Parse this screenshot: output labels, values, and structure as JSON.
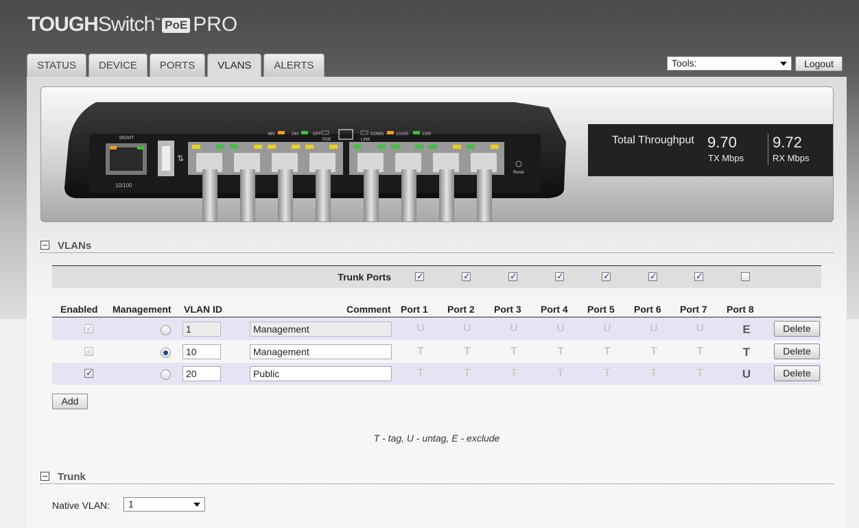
{
  "brand": {
    "part1": "TOUGH",
    "part2": "Switch",
    "tm": "™",
    "badge": "PoE",
    "part3": "PRO"
  },
  "tabs": [
    {
      "label": "STATUS",
      "active": false
    },
    {
      "label": "DEVICE",
      "active": false
    },
    {
      "label": "PORTS",
      "active": false
    },
    {
      "label": "VLANS",
      "active": true
    },
    {
      "label": "ALERTS",
      "active": false
    }
  ],
  "header": {
    "tools_value": "Tools:",
    "logout_label": "Logout"
  },
  "device_panel": {
    "mgmt_label": "MGMT",
    "mgmt_speed": "10/100",
    "legend_48v": "48V",
    "legend_24v": "24V",
    "legend_off": "OFF",
    "legend_poe": "POE",
    "legend_down": "DOWN",
    "legend_10100": "10/100",
    "legend_1000": "1000",
    "legend_link": "LINK",
    "reset_label": "Reset",
    "colors": {
      "amber": "#e8a020",
      "green": "#40c040",
      "yellow": "#e8d020"
    }
  },
  "throughput": {
    "title": "Total Throughput",
    "tx_value": "9.70",
    "tx_unit": "TX Mbps",
    "rx_value": "9.72",
    "rx_unit": "RX Mbps"
  },
  "vlans": {
    "section_title": "VLANs",
    "trunk_ports_label": "Trunk Ports",
    "trunk_ports": [
      true,
      true,
      true,
      true,
      true,
      true,
      true,
      false
    ],
    "columns": {
      "enabled": "Enabled",
      "management": "Management",
      "vlan_id": "VLAN ID",
      "comment": "Comment",
      "ports": [
        "Port 1",
        "Port 2",
        "Port 3",
        "Port 4",
        "Port 5",
        "Port 6",
        "Port 7",
        "Port 8"
      ]
    },
    "rows": [
      {
        "enabled": true,
        "enabled_disabled": true,
        "management": false,
        "vlan_id": "1",
        "vlan_readonly": true,
        "comment": "Management",
        "comment_readonly": true,
        "ports": [
          "U",
          "U",
          "U",
          "U",
          "U",
          "U",
          "U",
          "E"
        ],
        "delete_label": "Delete"
      },
      {
        "enabled": true,
        "enabled_disabled": true,
        "management": true,
        "vlan_id": "10",
        "vlan_readonly": false,
        "comment": "Management",
        "comment_readonly": false,
        "ports": [
          "T",
          "T",
          "T",
          "T",
          "T",
          "T",
          "T",
          "T"
        ],
        "delete_label": "Delete"
      },
      {
        "enabled": true,
        "enabled_disabled": false,
        "management": false,
        "vlan_id": "20",
        "vlan_readonly": false,
        "comment": "Public",
        "comment_readonly": false,
        "ports": [
          "T",
          "T",
          "T",
          "T",
          "T",
          "T",
          "T",
          "U"
        ],
        "delete_label": "Delete"
      }
    ],
    "add_label": "Add",
    "legend": "T - tag, U - untag, E - exclude"
  },
  "trunk": {
    "section_title": "Trunk",
    "native_vlan_label": "Native VLAN:",
    "native_vlan_value": "1"
  }
}
